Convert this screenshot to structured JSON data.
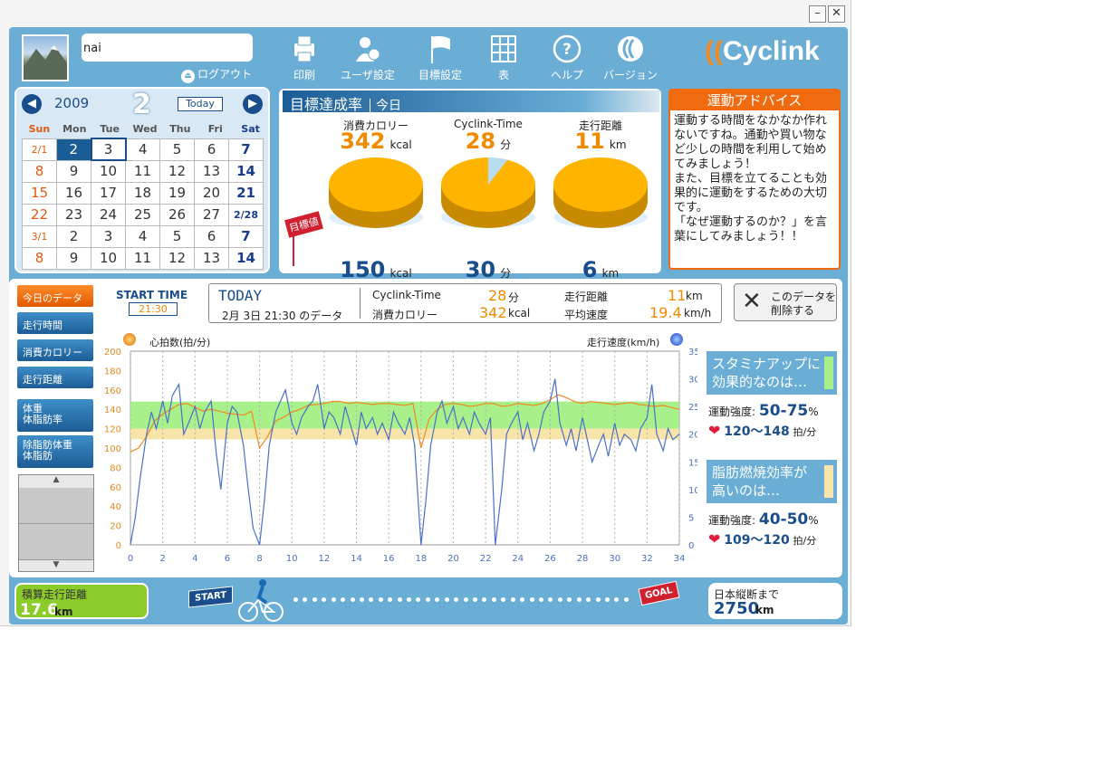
{
  "user": {
    "name": "nai",
    "logout": "ログアウト"
  },
  "toolbar": [
    {
      "label": "印刷",
      "icon": "printer-icon"
    },
    {
      "label": "ユーザ設定",
      "icon": "user-settings-icon"
    },
    {
      "label": "目標設定",
      "icon": "flag-icon"
    },
    {
      "label": "表",
      "icon": "table-icon"
    },
    {
      "label": "ヘルプ",
      "icon": "help-icon"
    },
    {
      "label": "バージョン",
      "icon": "version-icon"
    }
  ],
  "logo": "Cyclink",
  "calendar": {
    "year": "2009",
    "month": "2",
    "today_button": "Today",
    "weekdays": [
      "Sun",
      "Mon",
      "Tue",
      "Wed",
      "Thu",
      "Fri",
      "Sat"
    ],
    "weeks": [
      [
        "2/1",
        "2",
        "3",
        "4",
        "5",
        "6",
        "7"
      ],
      [
        "8",
        "9",
        "10",
        "11",
        "12",
        "13",
        "14"
      ],
      [
        "15",
        "16",
        "17",
        "18",
        "19",
        "20",
        "21"
      ],
      [
        "22",
        "23",
        "24",
        "25",
        "26",
        "27",
        "2/28"
      ],
      [
        "3/1",
        "2",
        "3",
        "4",
        "5",
        "6",
        "7"
      ],
      [
        "8",
        "9",
        "10",
        "11",
        "12",
        "13",
        "14"
      ]
    ]
  },
  "achievement": {
    "title": "目標達成率",
    "period": "今日",
    "goal_tag": "目標値",
    "items": [
      {
        "label": "消費カロリー",
        "value": "342",
        "unit": "kcal",
        "goal": "150",
        "goal_unit": "kcal",
        "ratio": 2.28
      },
      {
        "label": "Cyclink-Time",
        "value": "28",
        "unit": "分",
        "goal": "30",
        "goal_unit": "分",
        "ratio": 0.933
      },
      {
        "label": "走行距離",
        "value": "11",
        "unit": "km",
        "goal": "6",
        "goal_unit": "km",
        "ratio": 1.83
      }
    ]
  },
  "advice": {
    "title": "運動アドバイス",
    "text": "運動する時間をなかなか作れないですね。通勤や買い物など少しの時間を利用して始めてみましょう！\nまた、目標を立てることも効果的に運動をするための大切です。\n「なぜ運動するのか？」を言葉にしてみましょう！！"
  },
  "menu": [
    "今日のデータ",
    "走行時間",
    "消費カロリー",
    "走行距離"
  ],
  "menu2": [
    "体重\n体脂肪率",
    "除脂肪体重\n体脂肪"
  ],
  "session": {
    "start_label": "START TIME",
    "start_time": "21:30",
    "today": "TODAY",
    "date_line": "2月 3日 21:30 のデータ",
    "ct_label": "Cyclink-Time",
    "ct_value": "28",
    "ct_unit": "分",
    "dist_label": "走行距離",
    "dist_value": "11",
    "dist_unit": "km",
    "cal_label": "消費カロリー",
    "cal_value": "342",
    "cal_unit": "kcal",
    "speed_label": "平均速度",
    "speed_value": "19.4",
    "speed_unit": "km/h",
    "delete_label": "このデータを\n削除する"
  },
  "chart_legend": {
    "left": "心拍数(拍/分)",
    "right": "走行速度(km/h)"
  },
  "zones": [
    {
      "title": "スタミナアップに\n効果的なのは…",
      "intensity_label": "運動強度:",
      "intensity": "50-75",
      "pct": "%",
      "hr": "120～148",
      "hr_unit": "拍/分",
      "swatch": "#a8f08a"
    },
    {
      "title": "脂肪燃焼効率が\n高いのは…",
      "intensity_label": "運動強度:",
      "intensity": "40-50",
      "pct": "%",
      "hr": "109～120",
      "hr_unit": "拍/分",
      "swatch": "#f8e4a8"
    }
  ],
  "footer": {
    "total_label": "積算走行距離",
    "total_value": "17.6",
    "total_unit": "km",
    "start_sign": "START",
    "goal_sign": "GOAL",
    "remain_label": "日本縦断まで",
    "remain_value": "2750",
    "remain_unit": "km"
  },
  "chart_data": {
    "type": "line",
    "x_ticks": [
      0,
      2,
      4,
      6,
      8,
      10,
      12,
      14,
      16,
      18,
      20,
      22,
      24,
      26,
      28,
      30,
      32,
      34
    ],
    "y_left_ticks": [
      0,
      20,
      40,
      60,
      80,
      100,
      120,
      140,
      160,
      180,
      200
    ],
    "y_right_ticks": [
      0,
      5,
      10,
      15,
      20,
      25,
      30,
      35
    ],
    "xlim": [
      0,
      34
    ],
    "ylim_left": [
      0,
      200
    ],
    "ylim_right": [
      0,
      35
    ],
    "bands": [
      {
        "from": 120,
        "to": 148,
        "color": "#a8f08a"
      },
      {
        "from": 109,
        "to": 120,
        "color": "#f8e4a8"
      }
    ],
    "series": [
      {
        "axis": "left",
        "color": "#f08a20",
        "x": [
          0,
          0.5,
          1,
          1.5,
          2,
          2.5,
          3,
          3.5,
          4,
          4.5,
          5,
          5.5,
          6,
          6.5,
          7,
          7.5,
          8,
          8.5,
          9,
          9.5,
          10,
          10.5,
          11,
          11.5,
          12,
          12.5,
          13,
          13.5,
          14,
          14.5,
          15,
          15.5,
          16,
          16.5,
          17,
          17.5,
          18,
          18.5,
          19,
          19.5,
          20,
          20.5,
          21,
          21.5,
          22,
          22.5,
          23,
          23.5,
          24,
          24.5,
          25,
          25.5,
          26,
          26.5,
          27,
          27.5,
          28,
          28.5,
          29,
          29.5,
          30,
          30.5,
          31,
          31.5,
          32,
          32.5,
          33,
          33.5,
          34
        ],
        "y": [
          96,
          100,
          112,
          128,
          135,
          140,
          145,
          146,
          142,
          138,
          140,
          138,
          136,
          135,
          134,
          138,
          100,
          112,
          128,
          132,
          137,
          140,
          144,
          145,
          146,
          148,
          148,
          146,
          147,
          146,
          145,
          146,
          146,
          145,
          144,
          146,
          100,
          130,
          140,
          145,
          146,
          145,
          143,
          144,
          146,
          146,
          143,
          144,
          146,
          145,
          144,
          146,
          150,
          155,
          152,
          148,
          146,
          148,
          147,
          146,
          145,
          146,
          147,
          145,
          144,
          143,
          144,
          142,
          140
        ]
      },
      {
        "axis": "right",
        "color": "#4a70c8",
        "x": [
          0,
          0.3,
          0.6,
          1,
          1.3,
          1.6,
          2,
          2.3,
          2.6,
          3,
          3.3,
          3.6,
          4,
          4.3,
          4.6,
          5,
          5.3,
          5.6,
          6,
          6.3,
          6.6,
          7,
          7.3,
          7.6,
          8,
          8.3,
          8.6,
          9,
          9.3,
          9.6,
          10,
          10.3,
          10.6,
          11,
          11.3,
          11.6,
          12,
          12.3,
          12.6,
          13,
          13.3,
          13.6,
          14,
          14.3,
          14.6,
          15,
          15.3,
          15.6,
          16,
          16.3,
          16.6,
          17,
          17.3,
          17.6,
          18,
          18.3,
          18.6,
          19,
          19.3,
          19.6,
          20,
          20.3,
          20.6,
          21,
          21.3,
          21.6,
          22,
          22.3,
          22.6,
          23,
          23.3,
          23.6,
          24,
          24.3,
          24.6,
          25,
          25.3,
          25.6,
          26,
          26.3,
          26.6,
          27,
          27.3,
          27.6,
          28,
          28.3,
          28.6,
          29,
          29.3,
          29.6,
          30,
          30.3,
          30.6,
          31,
          31.3,
          31.6,
          32,
          32.3,
          32.6,
          33,
          33.3,
          33.6,
          34
        ],
        "y": [
          0,
          5,
          12,
          20,
          24,
          21,
          26,
          22,
          27,
          29,
          20,
          22,
          25,
          21,
          24,
          26,
          17,
          10,
          22,
          25,
          24,
          18,
          10,
          3,
          0,
          8,
          18,
          24,
          26,
          28,
          22,
          20,
          23,
          25,
          26,
          29,
          21,
          24,
          23,
          20,
          25,
          22,
          18,
          24,
          21,
          23,
          20,
          22,
          19,
          24,
          22,
          20,
          23,
          18,
          0,
          8,
          18,
          24,
          26,
          22,
          25,
          21,
          23,
          20,
          24,
          22,
          20,
          23,
          0,
          10,
          20,
          22,
          24,
          19,
          22,
          17,
          20,
          24,
          26,
          30,
          22,
          18,
          21,
          17,
          23,
          19,
          15,
          18,
          20,
          16,
          22,
          18,
          20,
          19,
          17,
          21,
          23,
          29,
          20,
          17,
          21,
          19,
          20
        ]
      }
    ]
  }
}
